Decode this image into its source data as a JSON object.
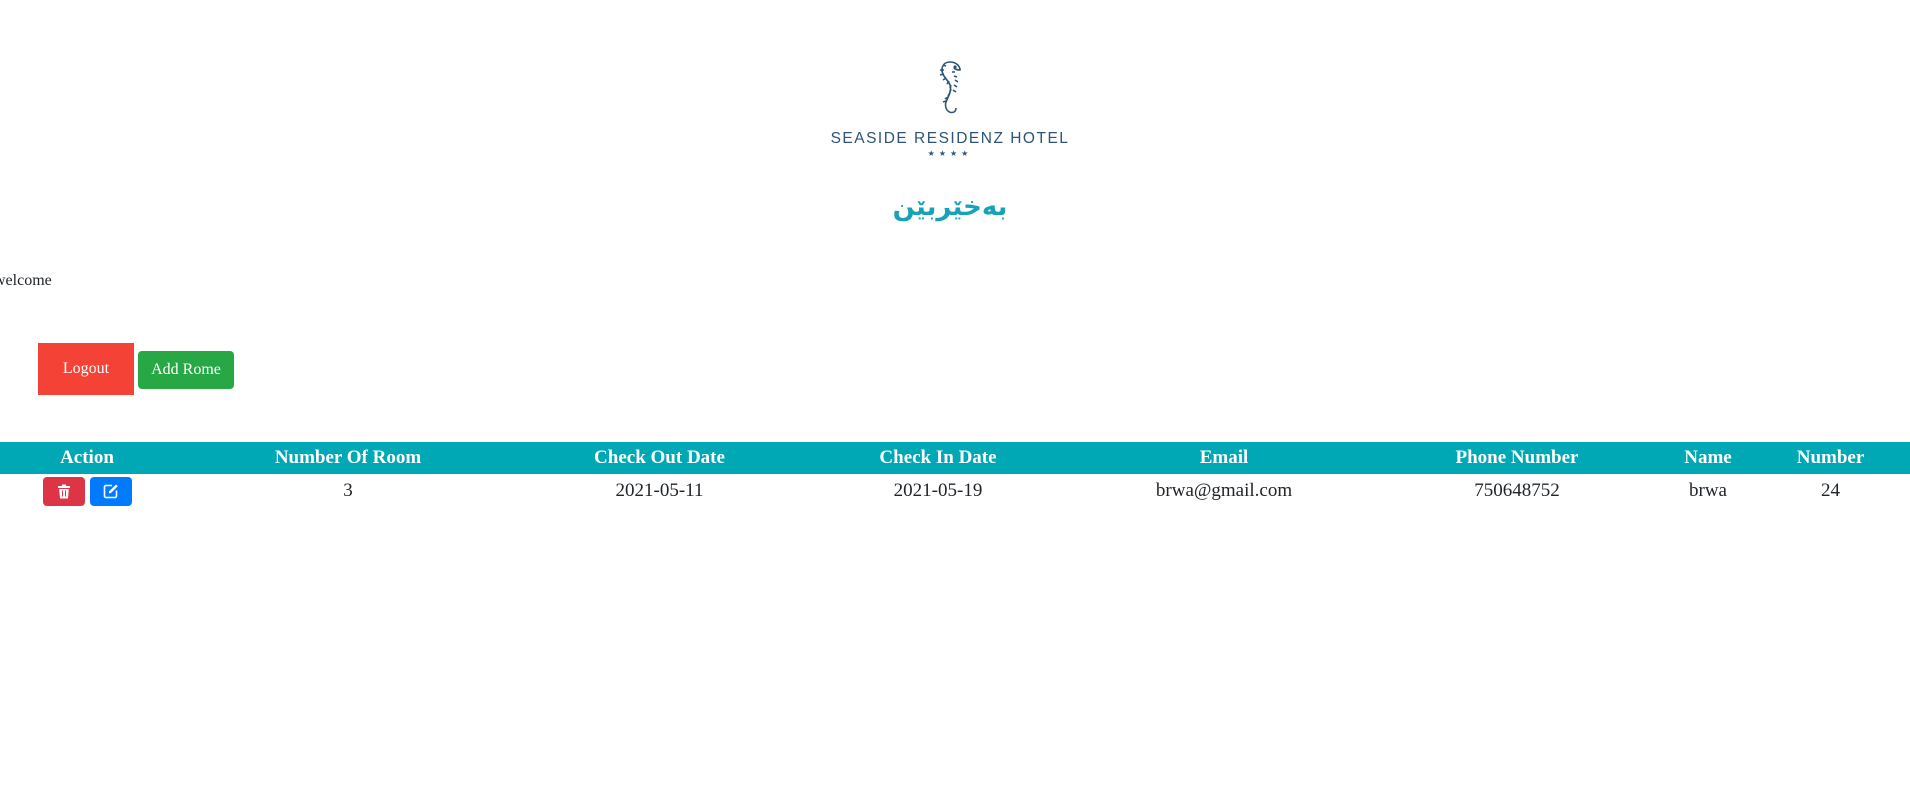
{
  "logo": {
    "name": "SEASIDE RESIDENZ HOTEL",
    "stars": "★★★★",
    "color": "#2d5478"
  },
  "welcome_heading": "بەخێربێن",
  "welcome_text": "welcome",
  "buttons": {
    "logout": "Logout",
    "add_room": "Add Rome"
  },
  "colors": {
    "header_bg": "#00a8b5",
    "logout": "#f44336",
    "add": "#28a745",
    "delete": "#dc3545",
    "edit": "#007bff",
    "heading": "#17a2b8"
  },
  "table": {
    "columns": [
      "Action",
      "Number Of Room",
      "Check Out Date",
      "Check In Date",
      "Email",
      "Phone Number",
      "Name",
      "Number"
    ],
    "rows": [
      {
        "number_of_room": "3",
        "check_out_date": "2021-05-11",
        "check_in_date": "2021-05-19",
        "email": "brwa@gmail.com",
        "phone_number": "750648752",
        "name": "brwa",
        "number": "24"
      }
    ]
  },
  "icons": {
    "delete": "trash-icon",
    "edit": "edit-icon"
  }
}
